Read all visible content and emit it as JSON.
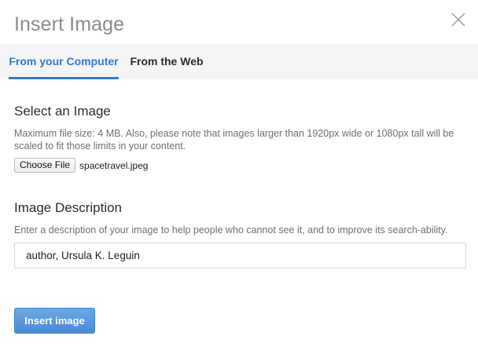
{
  "dialog": {
    "title": "Insert Image",
    "close_icon": "close-icon"
  },
  "tabs": [
    {
      "label": "From your Computer",
      "active": true
    },
    {
      "label": "From the Web",
      "active": false
    }
  ],
  "select_image": {
    "heading": "Select an Image",
    "help": "Maximum file size: 4 MB. Also, please note that images larger than 1920px wide or 1080px tall will be scaled to fit those limits in your content.",
    "choose_file_label": "Choose File",
    "file_name": "spacetravel.jpeg"
  },
  "description": {
    "heading": "Image Description",
    "help": "Enter a description of your image to help people who cannot see it, and to improve its search-ability.",
    "value": "author, Ursula K. Leguin"
  },
  "insert_button_label": "Insert image",
  "colors": {
    "accent": "#2e7bd5",
    "button": "#4a8ad6",
    "tabbar_bg": "#f5f5f5"
  }
}
